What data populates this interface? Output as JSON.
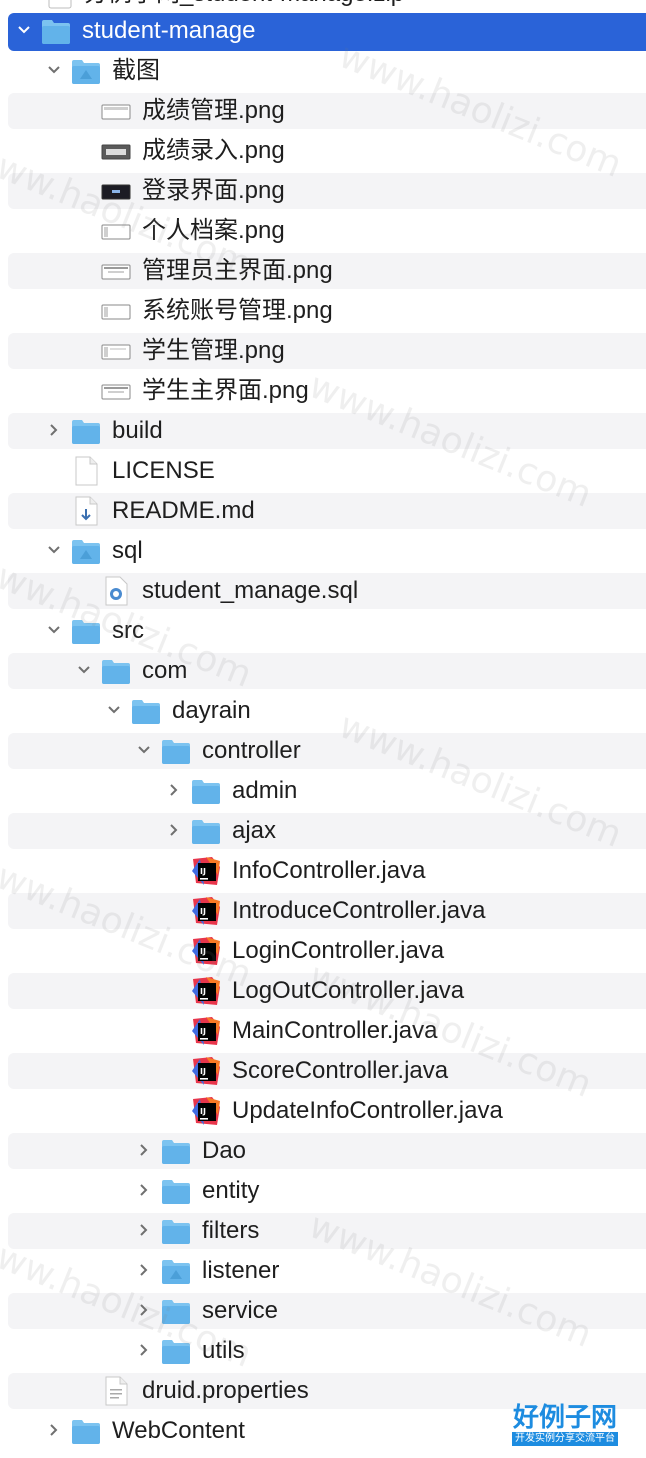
{
  "header_partial": {
    "label": "分例子网_student-manage.zip"
  },
  "rows": [
    {
      "label": "student-manage",
      "icon": "folder-icon",
      "selected": true
    },
    {
      "label": "截图",
      "icon": "folder-icon"
    },
    {
      "label": "成绩管理.png",
      "icon": "image-file-icon"
    },
    {
      "label": "成绩录入.png",
      "icon": "image-file-icon"
    },
    {
      "label": "登录界面.png",
      "icon": "image-file-icon"
    },
    {
      "label": "个人档案.png",
      "icon": "image-file-icon"
    },
    {
      "label": "管理员主界面.png",
      "icon": "image-file-icon"
    },
    {
      "label": "系统账号管理.png",
      "icon": "image-file-icon"
    },
    {
      "label": "学生管理.png",
      "icon": "image-file-icon"
    },
    {
      "label": "学生主界面.png",
      "icon": "image-file-icon"
    },
    {
      "label": "build",
      "icon": "folder-icon"
    },
    {
      "label": "LICENSE",
      "icon": "document-icon"
    },
    {
      "label": "README.md",
      "icon": "markdown-file-icon"
    },
    {
      "label": "sql",
      "icon": "folder-icon"
    },
    {
      "label": "student_manage.sql",
      "icon": "sql-file-icon"
    },
    {
      "label": "src",
      "icon": "folder-icon"
    },
    {
      "label": "com",
      "icon": "folder-icon"
    },
    {
      "label": "dayrain",
      "icon": "folder-icon"
    },
    {
      "label": "controller",
      "icon": "folder-icon"
    },
    {
      "label": "admin",
      "icon": "folder-icon"
    },
    {
      "label": "ajax",
      "icon": "folder-icon"
    },
    {
      "label": "InfoController.java",
      "icon": "intellij-java-file-icon"
    },
    {
      "label": "IntroduceController.java",
      "icon": "intellij-java-file-icon"
    },
    {
      "label": "LoginController.java",
      "icon": "intellij-java-file-icon"
    },
    {
      "label": "LogOutController.java",
      "icon": "intellij-java-file-icon"
    },
    {
      "label": "MainController.java",
      "icon": "intellij-java-file-icon"
    },
    {
      "label": "ScoreController.java",
      "icon": "intellij-java-file-icon"
    },
    {
      "label": "UpdateInfoController.java",
      "icon": "intellij-java-file-icon"
    },
    {
      "label": "Dao",
      "icon": "folder-icon"
    },
    {
      "label": "entity",
      "icon": "folder-icon"
    },
    {
      "label": "filters",
      "icon": "folder-icon"
    },
    {
      "label": "listener",
      "icon": "folder-icon"
    },
    {
      "label": "service",
      "icon": "folder-icon"
    },
    {
      "label": "utils",
      "icon": "folder-icon"
    },
    {
      "label": "druid.properties",
      "icon": "text-file-icon"
    },
    {
      "label": "WebContent",
      "icon": "folder-icon"
    }
  ],
  "watermark": "www.haolizi.com",
  "brand": {
    "title": "好例子网",
    "subtitle": "开发实例分享交流平台"
  },
  "colors": {
    "selection": "#2a63d8",
    "folder": "#5aaee8",
    "stripe": "#f4f4f6",
    "brand": "#1d8ce0"
  }
}
